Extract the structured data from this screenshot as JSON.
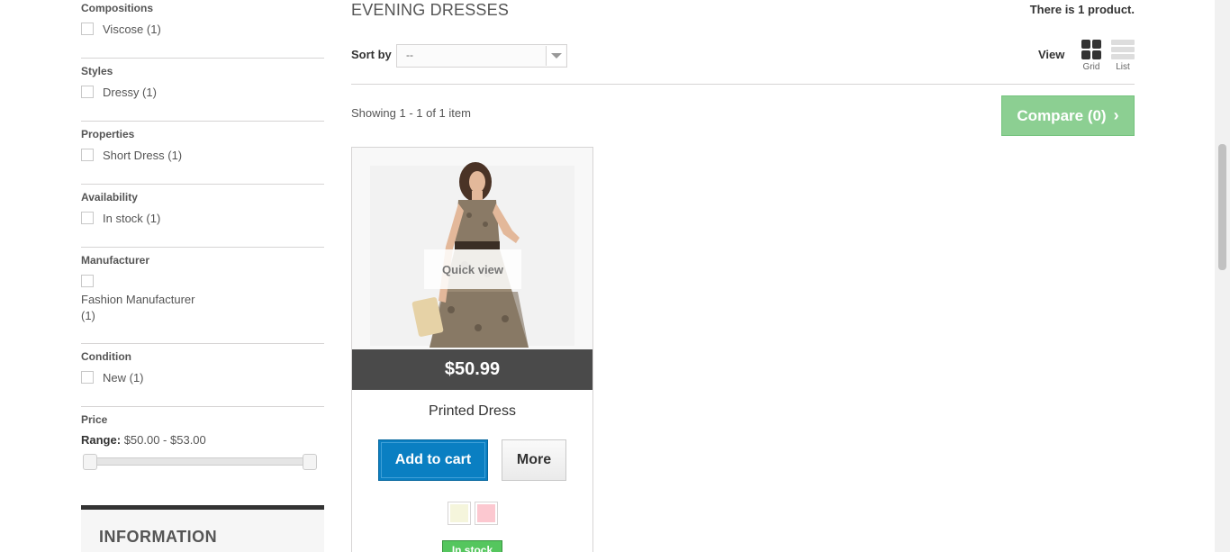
{
  "sidebar": {
    "filters": [
      {
        "title": "Compositions",
        "items": [
          "Viscose (1)"
        ]
      },
      {
        "title": "Styles",
        "items": [
          "Dressy (1)"
        ]
      },
      {
        "title": "Properties",
        "items": [
          "Short Dress (1)"
        ]
      },
      {
        "title": "Availability",
        "items": [
          "In stock (1)"
        ]
      },
      {
        "title": "Manufacturer",
        "items": [
          "Fashion Manufacturer",
          "(1)"
        ]
      },
      {
        "title": "Condition",
        "items": [
          "New (1)"
        ]
      }
    ],
    "price": {
      "title": "Price",
      "range_label": "Range:",
      "range_value": "$50.00 - $53.00"
    },
    "information_title": "INFORMATION"
  },
  "main": {
    "category_title": "EVENING DRESSES",
    "product_count": "There is 1 product.",
    "sort_label": "Sort by",
    "sort_value": "--",
    "view_label": "View",
    "view_grid": "Grid",
    "view_list": "List",
    "showing": "Showing 1 - 1 of 1 item",
    "compare_label": "Compare (0)"
  },
  "product": {
    "quick_view": "Quick view",
    "price": "$50.99",
    "name": "Printed Dress",
    "add_to_cart": "Add to cart",
    "more": "More",
    "swatch_colors": [
      "#f5f5dc",
      "#fcc8d0"
    ],
    "availability": "In stock"
  },
  "colors": {
    "accent_blue": "#0a7fc2",
    "compare_green": "#8ccf92",
    "stock_green": "#55c65e",
    "price_bar": "#4a4a4a"
  }
}
